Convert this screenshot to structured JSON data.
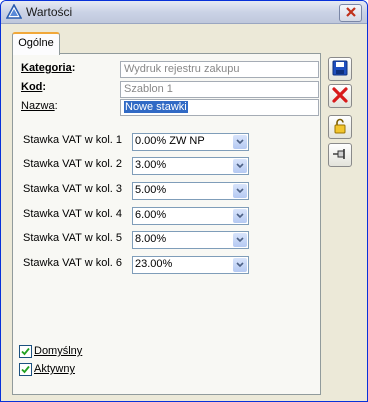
{
  "window": {
    "title": "Wartości"
  },
  "tabs": [
    {
      "label": "Ogólne"
    }
  ],
  "form": {
    "kategoria": {
      "label": "Kategoria",
      "value": "Wydruk rejestru zakupu"
    },
    "kod": {
      "label": "Kod",
      "value": "Szablon 1"
    },
    "nazwa": {
      "label": "Nazwa",
      "value": "Nowe stawki"
    }
  },
  "vat_rows": [
    {
      "label": "Stawka VAT w kol. 1",
      "value": "0.00% ZW NP"
    },
    {
      "label": "Stawka VAT w kol. 2",
      "value": "3.00%"
    },
    {
      "label": "Stawka VAT w kol. 3",
      "value": "5.00%"
    },
    {
      "label": "Stawka VAT w kol. 4",
      "value": "6.00%"
    },
    {
      "label": "Stawka VAT w kol. 5",
      "value": "8.00%"
    },
    {
      "label": "Stawka VAT w kol. 6",
      "value": "23.00%"
    }
  ],
  "checkboxes": [
    {
      "label": "Domyślny",
      "checked": true
    },
    {
      "label": "Aktywny",
      "checked": true
    }
  ],
  "toolbar": [
    {
      "icon": "save-icon"
    },
    {
      "icon": "cancel-icon"
    },
    {
      "icon": "lock-icon"
    },
    {
      "icon": "pin-icon"
    }
  ],
  "colors": {
    "accent": "#f1a83a",
    "selection": "#316ac5",
    "close_x": "#c0311b"
  }
}
